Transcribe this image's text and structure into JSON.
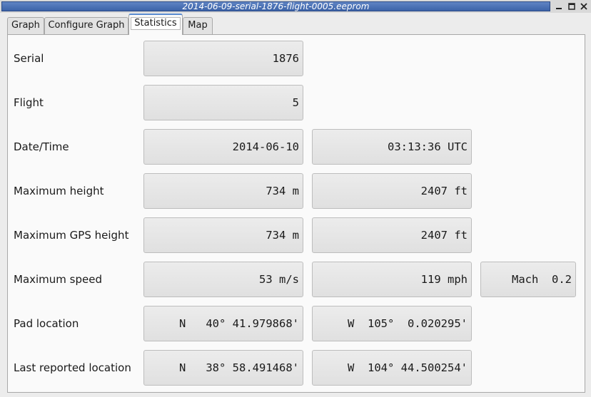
{
  "window": {
    "title": "2014-06-09-serial-1876-flight-0005.eeprom"
  },
  "tabs": [
    "Graph",
    "Configure Graph",
    "Statistics",
    "Map"
  ],
  "rows": [
    {
      "label": "Serial",
      "values": [
        "1876"
      ]
    },
    {
      "label": "Flight",
      "values": [
        "5"
      ]
    },
    {
      "label": "Date/Time",
      "values": [
        "2014-06-10",
        "03:13:36 UTC"
      ]
    },
    {
      "label": "Maximum height",
      "values": [
        "734 m",
        "2407 ft"
      ]
    },
    {
      "label": "Maximum GPS height",
      "values": [
        "734 m",
        "2407 ft"
      ]
    },
    {
      "label": "Maximum speed",
      "values": [
        "53 m/s",
        "119 mph",
        "Mach  0.2"
      ]
    },
    {
      "label": "Pad location",
      "values": [
        "N   40° 41.979868'",
        "W  105°  0.020295'"
      ]
    },
    {
      "label": "Last reported location",
      "values": [
        "N   38° 58.491468'",
        "W  104° 44.500254'"
      ]
    }
  ]
}
